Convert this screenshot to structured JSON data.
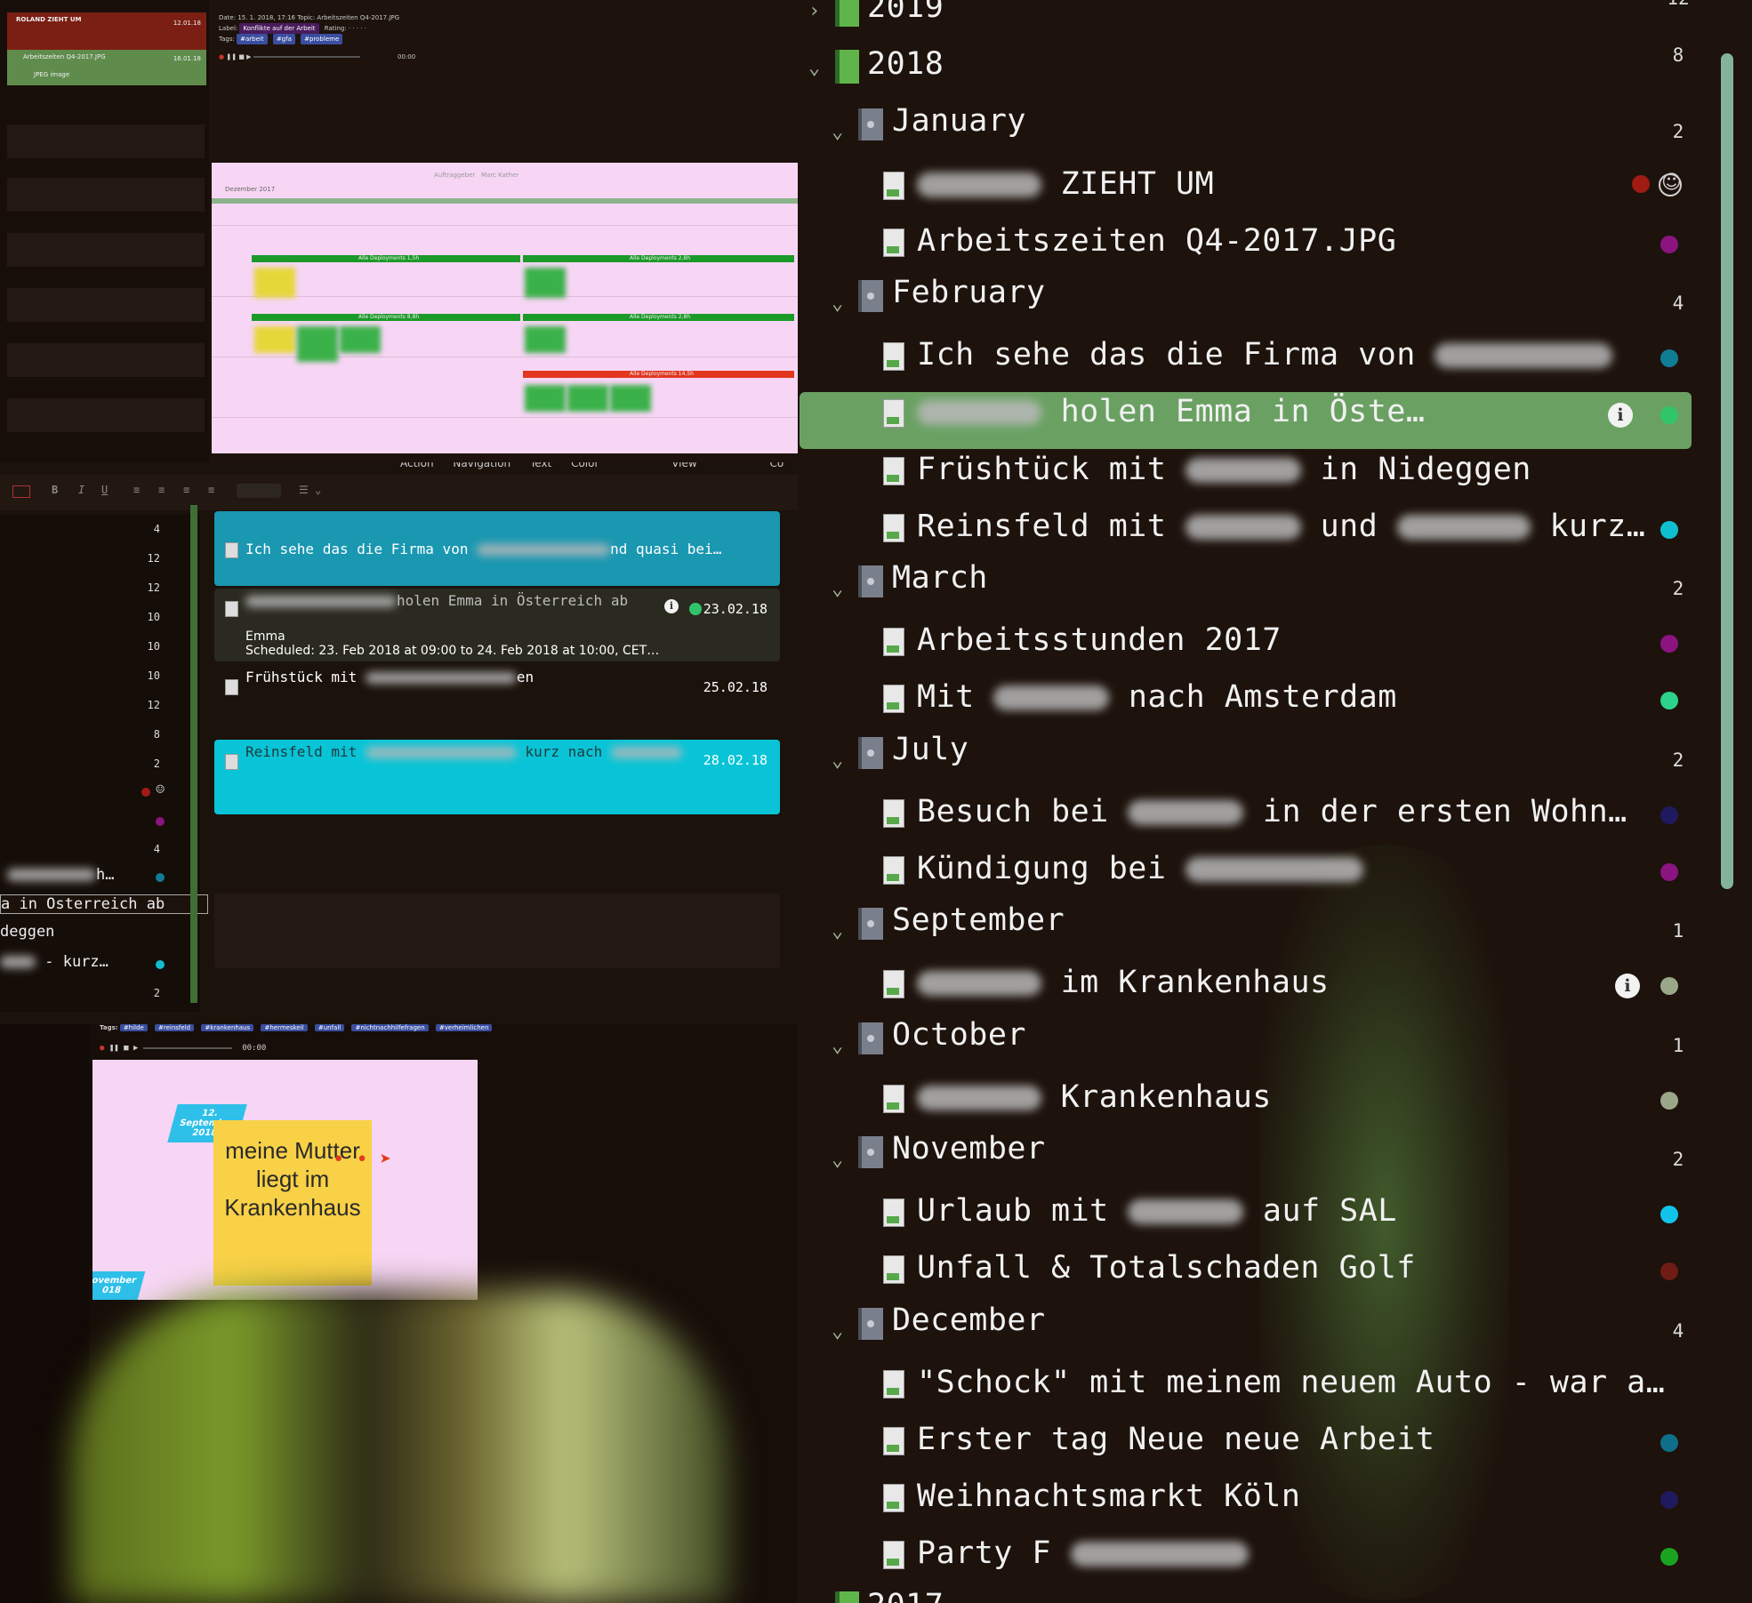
{
  "top_left": {
    "card_red_title": "ROLAND ZIEHT UM",
    "card_red_time": "12.01.18",
    "card_green_title": "Arbeitszeiten Q4-2017.JPG",
    "card_green_time": "16.01.18",
    "card_green_sub": "JPEG image",
    "meta_line1": "Date: 15. 1. 2018, 17:16  Topic: Arbeitszeiten Q4-2017.JPG",
    "meta_label_key": "Label:",
    "meta_label_val": "Konflikte auf der Arbeit",
    "meta_rating": "Rating:",
    "meta_tags_key": "Tags:",
    "meta_tags": [
      "#arbeit",
      "#gfa",
      "#probleme"
    ],
    "player_time": "00:00",
    "preview_header": "Dezember 2017",
    "preview_filter_label": "Auftraggeber",
    "preview_filter_value": "Marc Kather",
    "preview_bars": [
      "Alle Deployments 1,5h",
      "Alle Deployments 2,8h",
      "Alle Deployments 8,8h",
      "Alle Deployments 2,8h",
      "Alle Deployments 14,5h"
    ]
  },
  "mid_left": {
    "menu": [
      "Action",
      "Navigation",
      "Text Color",
      "View",
      "Co"
    ],
    "toolbar_format": [
      "B",
      "I",
      "U"
    ],
    "numbers": [
      "4",
      "12",
      "12",
      "10",
      "10",
      "10",
      "12",
      "8",
      "2",
      "",
      "",
      "4",
      "",
      "",
      "",
      "2"
    ],
    "overflow_lines": [
      "h…",
      "a in Osterreich ab",
      "deggen",
      " - kurz…"
    ],
    "cards": [
      {
        "title": "Ich sehe das die Firma von",
        "tail": "nd quasi bei…",
        "date": "",
        "color": "#1a97b1"
      },
      {
        "title": "holen Emma in Österreich ab",
        "date": "23.02.18",
        "sub1": "Emma",
        "sub2": "Scheduled: 23. Feb 2018 at 09:00 to 24. Feb 2018 at 10:00, CET…",
        "color": "#2a2a20"
      },
      {
        "title": "Frühstück mit",
        "tail": "en",
        "date": "25.02.18",
        "color": "#1b120c"
      },
      {
        "title": "Reinsfeld mit",
        "tail": "kurz nach",
        "date": "28.02.18",
        "color": "#08c4d6"
      }
    ]
  },
  "bottom_left": {
    "tags_label": "Tags:",
    "tags": [
      "#hilde",
      "#reinsfeld",
      "#krankenhaus",
      "#hermeskeil",
      "#unfall",
      "#nichtnachhilfefragen",
      "#verheimlichen"
    ],
    "player_time": "00:00",
    "date_badge": "12. September 2018",
    "date_badge_line1": "12.",
    "date_badge_line2": "September",
    "date_badge_line3": "2018",
    "date_badge2_line1": "ovember",
    "date_badge2_line2": "018",
    "note_text": "meine Mutter liegt im Krankenhaus"
  },
  "outline": {
    "rows": [
      {
        "kind": "year",
        "label": "2019",
        "count": "12",
        "collapsed": true
      },
      {
        "kind": "year",
        "label": "2018",
        "count": "8"
      },
      {
        "kind": "month",
        "label": "January",
        "count": "2"
      },
      {
        "kind": "entry",
        "label": "ZIEHT UM",
        "redact_before": true,
        "dot": "#a01b14",
        "smiley": true
      },
      {
        "kind": "entry",
        "label": "Arbeitszeiten Q4-2017.JPG",
        "dot": "#8b1480"
      },
      {
        "kind": "month",
        "label": "February",
        "count": "4"
      },
      {
        "kind": "entry",
        "label": "Ich sehe das die Firma von",
        "redact_after": true,
        "dot": "#0f7e94"
      },
      {
        "kind": "entry",
        "label": "holen Emma in Öste…",
        "redact_before": true,
        "dot": "#31c56a",
        "selected": true,
        "info": true
      },
      {
        "kind": "entry",
        "label": "Früshtück mit",
        "label2": "in Nideggen",
        "dot": ""
      },
      {
        "kind": "entry",
        "label": "Reinsfeld mit",
        "label2": "und",
        "label3": "kurz…",
        "dot": "#10bfcf"
      },
      {
        "kind": "month",
        "label": "March",
        "count": "2"
      },
      {
        "kind": "entry",
        "label": "Arbeitsstunden 2017",
        "dot": "#8b1480"
      },
      {
        "kind": "entry",
        "label": "Mit",
        "label2": "nach Amsterdam",
        "dot": "#2dd38a"
      },
      {
        "kind": "month",
        "label": "July",
        "count": "2"
      },
      {
        "kind": "entry",
        "label": "Besuch bei",
        "label2": "in der ersten Wohn…",
        "dot": "#1f1a5e"
      },
      {
        "kind": "entry",
        "label": "Kündigung bei",
        "redact_after": true,
        "dot": "#8b1480"
      },
      {
        "kind": "month",
        "label": "September",
        "count": "1"
      },
      {
        "kind": "entry",
        "label": "im Krankenhaus",
        "redact_before": true,
        "dot": "#9aa88a",
        "info": true
      },
      {
        "kind": "month",
        "label": "October",
        "count": "1"
      },
      {
        "kind": "entry",
        "label": "Krankenhaus",
        "redact_before": true,
        "dot": "#9aa88a"
      },
      {
        "kind": "month",
        "label": "November",
        "count": "2"
      },
      {
        "kind": "entry",
        "label": "Urlaub mit",
        "label2": "auf SAL",
        "dot": "#11c3ea"
      },
      {
        "kind": "entry",
        "label": "Unfall & Totalschaden Golf",
        "dot": "#6e1c14"
      },
      {
        "kind": "month",
        "label": "December",
        "count": "4"
      },
      {
        "kind": "entry",
        "label": "\"Schock\" mit meinem neuem Auto - war a…",
        "dot": ""
      },
      {
        "kind": "entry",
        "label": "Erster tag Neue neue Arbeit",
        "dot": "#0f6f8a"
      },
      {
        "kind": "entry",
        "label": "Weihnachtsmarkt Köln",
        "dot": "#1f1a5e"
      },
      {
        "kind": "entry",
        "label": "Party F",
        "redact_after": true,
        "dot": "#1aa321"
      },
      {
        "kind": "year",
        "label": "2017",
        "count": ""
      }
    ]
  }
}
